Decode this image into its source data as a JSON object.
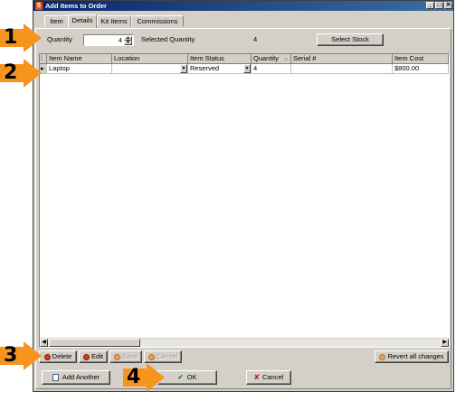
{
  "window": {
    "title": "Add Items to Order",
    "min_glyph": "_",
    "max_glyph": "□",
    "close_glyph": "✕"
  },
  "tabs": [
    {
      "label": "Item"
    },
    {
      "label": "Details"
    },
    {
      "label": "Kit Items"
    },
    {
      "label": "Commissions"
    }
  ],
  "details": {
    "quantity_label": "Quantity",
    "quantity_value": "4",
    "selected_quantity_label": "Selected Quantity",
    "selected_quantity_value": "4",
    "select_stock_label": "Select Stock"
  },
  "grid": {
    "columns": [
      "Item Name",
      "Location",
      "Item Status",
      "Quantity",
      "Serial #",
      "Item Cost"
    ],
    "rows": [
      {
        "item_name": "Laptop",
        "location": "",
        "item_status": "Reserved",
        "quantity": "4",
        "serial": "",
        "item_cost": "$800.00"
      }
    ]
  },
  "actions": {
    "delete": "Delete",
    "edit": "Edit",
    "save": "Save",
    "cancel": "Cancel",
    "revert": "Revert all changes"
  },
  "footer": {
    "add_another": "Add Another",
    "ok": "OK",
    "cancel": "Cancel"
  },
  "callouts": [
    "1",
    "2",
    "3",
    "4"
  ],
  "colors": {
    "callout_orange": "#f7941d",
    "title_bar": "#0a246a",
    "window_face": "#d4d0c8"
  }
}
